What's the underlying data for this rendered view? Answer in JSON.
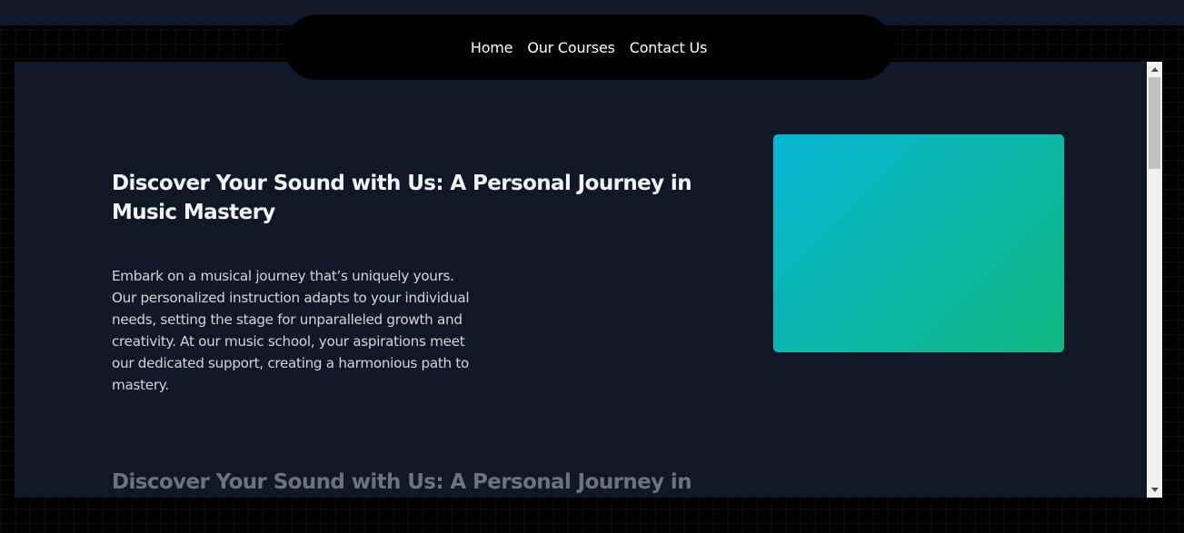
{
  "nav": {
    "items": [
      {
        "label": "Home"
      },
      {
        "label": "Our Courses"
      },
      {
        "label": "Contact Us"
      }
    ]
  },
  "hero": {
    "title": "Discover Your Sound with Us: A Personal Journey in Music Mastery",
    "body": "Embark on a musical journey that’s uniquely yours. Our personalized instruction adapts to your individual needs, setting the stage for unparalleled growth and creativity. At our music school, your aspirations meet our dedicated support, creating a harmonious path to mastery.",
    "image_gradient": [
      "#06b6d4",
      "#10b981"
    ]
  },
  "next_section": {
    "title": "Discover Your Sound with Us: A Personal Journey in"
  },
  "colors": {
    "panel_bg": "#101828",
    "page_bg": "#020202",
    "navbar_bg": "#000000",
    "scrollbar_track": "#f1f1f1",
    "scrollbar_thumb": "#c1c1c1"
  }
}
